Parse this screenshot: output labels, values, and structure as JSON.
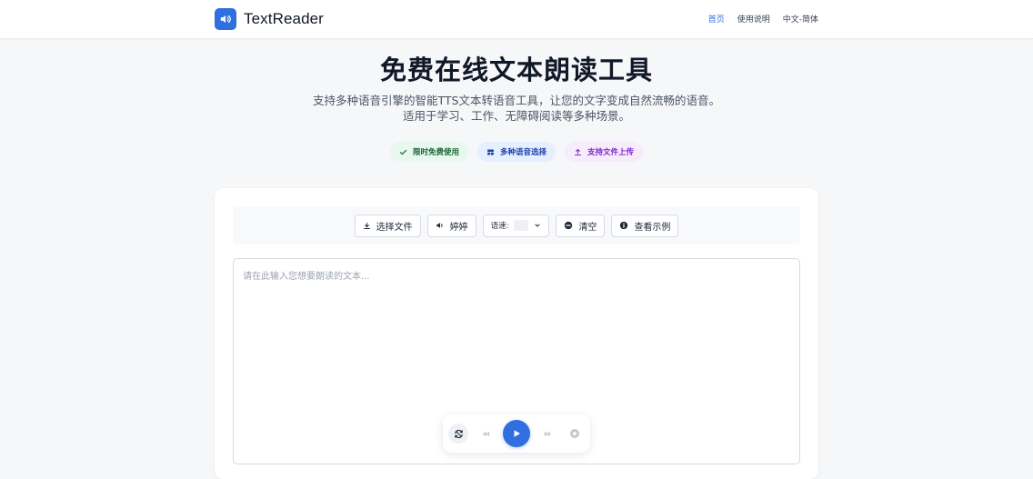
{
  "brand": {
    "name": "TextReader",
    "icon": "speaker-icon",
    "accent": "#2f6fdf"
  },
  "nav": {
    "items": [
      {
        "label": "首页",
        "active": true
      },
      {
        "label": "使用说明",
        "active": false
      },
      {
        "label": "中文-简体",
        "active": false
      }
    ]
  },
  "hero": {
    "title": "免费在线文本朗读工具",
    "subtitle": "支持多种语音引擎的智能TTS文本转语音工具，让您的文字变成自然流畅的语音。适用于学习、工作、无障碍阅读等多种场景。",
    "badges": [
      {
        "label": "限时免费使用",
        "icon": "check-icon",
        "color": "#166534"
      },
      {
        "label": "多种语音选择",
        "icon": "voices-icon",
        "color": "#1e40af"
      },
      {
        "label": "支持文件上传",
        "icon": "upload-icon",
        "color": "#7e22ce"
      }
    ]
  },
  "toolbar": {
    "choose_file": "选择文件",
    "voice": "婷婷",
    "speed_label": "语速:",
    "clear": "清空",
    "example": "查看示例"
  },
  "editor": {
    "placeholder": "请在此输入您想要朗读的文本..."
  },
  "player": {
    "icons": [
      "loop-icon",
      "rewind-icon",
      "play-icon",
      "forward-icon",
      "stop-icon"
    ]
  }
}
